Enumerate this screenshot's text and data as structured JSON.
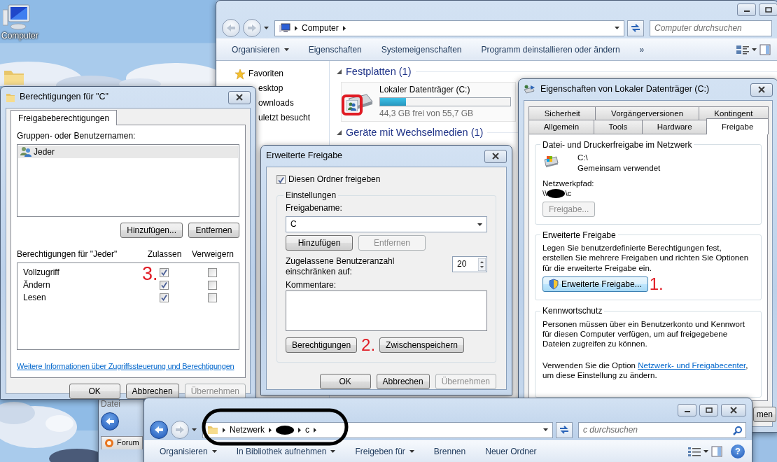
{
  "desktop": {
    "icons": [
      {
        "kind": "computer",
        "label": "Computer"
      },
      {
        "kind": "folder"
      }
    ]
  },
  "browser_behind": {
    "menu": "Datei",
    "tab": "Forum"
  },
  "explorer": {
    "address": [
      "Computer"
    ],
    "search_placeholder": "Computer durchsuchen",
    "toolbar": [
      {
        "label": "Organisieren",
        "dropdown": true
      },
      {
        "label": "Eigenschaften",
        "dropdown": false
      },
      {
        "label": "Systemeigenschaften",
        "dropdown": false
      },
      {
        "label": "Programm deinstallieren oder ändern",
        "dropdown": false
      },
      {
        "label": "»",
        "dropdown": false
      }
    ],
    "sidebar": [
      {
        "kind": "favorites",
        "label": "Favoriten"
      },
      {
        "kind": "link",
        "label": "esktop"
      },
      {
        "kind": "link",
        "label": "ownloads"
      },
      {
        "kind": "link",
        "label": "uletzt besucht"
      }
    ],
    "groups": [
      {
        "title": "Festplatten (1)",
        "expanded": true,
        "drives": [
          {
            "name": "Lokaler Datenträger (C:)",
            "level": 0.2,
            "space": "44,3 GB frei von 55,7 GB",
            "shared": true,
            "highlighted": true
          }
        ]
      },
      {
        "title": "Geräte mit Wechselmedien (1)",
        "expanded": true
      }
    ]
  },
  "permissions_dialog": {
    "title": "Berechtigungen für \"C\"",
    "tabs": [
      {
        "label": "Freigabeberechtigungen",
        "selected": true
      }
    ],
    "users_label": "Gruppen- oder Benutzernamen:",
    "users": [
      {
        "name": "Jeder",
        "selected": true
      }
    ],
    "user_buttons": [
      {
        "label": "Hinzufügen...",
        "disabled": false
      },
      {
        "label": "Entfernen",
        "disabled": false
      }
    ],
    "permissions_label": "Berechtigungen für \"Jeder\"",
    "columns": [
      "Zulassen",
      "Verweigern"
    ],
    "permissions": [
      {
        "name": "Vollzugriff",
        "allow": true,
        "deny": false
      },
      {
        "name": "Ändern",
        "allow": true,
        "deny": false
      },
      {
        "name": "Lesen",
        "allow": true,
        "deny": false
      }
    ],
    "annotation": "3.",
    "link": "Weitere Informationen über Zugriffssteuerung und Berechtigungen",
    "buttons": [
      {
        "label": "OK",
        "disabled": false
      },
      {
        "label": "Abbrechen",
        "disabled": false
      },
      {
        "label": "Übernehmen",
        "disabled": true
      }
    ]
  },
  "advanced_sharing_dialog": {
    "title": "Erweiterte Freigabe",
    "share": {
      "label": "Diesen Ordner freigeben",
      "checked": true
    },
    "group": "Einstellungen",
    "name_label": "Freigabename:",
    "name_value": "C",
    "name_buttons": [
      {
        "label": "Hinzufügen",
        "disabled": false
      },
      {
        "label": "Entfernen",
        "disabled": true
      }
    ],
    "limit_label": "Zugelassene Benutzeranzahl einschränken auf:",
    "limit_value": "20",
    "comment_label": "Kommentare:",
    "buttons_inner": [
      {
        "label": "Berechtigungen",
        "disabled": false
      },
      {
        "label": "Zwischenspeichern",
        "disabled": false
      }
    ],
    "annotation": "2.",
    "buttons": [
      {
        "label": "OK",
        "disabled": false
      },
      {
        "label": "Abbrechen",
        "disabled": false
      },
      {
        "label": "Übernehmen",
        "disabled": true
      }
    ]
  },
  "properties_dialog": {
    "title": "Eigenschaften von Lokaler Datenträger (C:)",
    "tab_rows": [
      [
        {
          "label": "Sicherheit",
          "selected": false
        },
        {
          "label": "Vorgängerversionen",
          "selected": false
        },
        {
          "label": "Kontingent",
          "selected": false
        }
      ],
      [
        {
          "label": "Allgemein",
          "selected": false
        },
        {
          "label": "Tools",
          "selected": false
        },
        {
          "label": "Hardware",
          "selected": false
        },
        {
          "label": "Freigabe",
          "selected": true
        }
      ]
    ],
    "network": {
      "title": "Datei- und Druckerfreigabe im Netzwerk",
      "path": "C:\\",
      "status": "Gemeinsam verwendet",
      "path_label": "Netzwerkpfad:",
      "path_prefix": "\\\\",
      "path_redacted": true,
      "path_suffix": "\\c",
      "button": {
        "label": "Freigabe...",
        "disabled": true
      }
    },
    "advanced": {
      "title": "Erweiterte Freigabe",
      "text": "Legen Sie benutzerdefinierte Berechtigungen fest, erstellen Sie mehrere Freigaben und richten Sie Optionen für die erweiterte Freigabe ein.",
      "button": {
        "label": "Erweiterte Freigabe...",
        "disabled": false
      },
      "annotation": "1."
    },
    "password": {
      "title": "Kennwortschutz",
      "text": "Personen müssen über ein Benutzerkonto und Kennwort für diesen Computer verfügen, um auf freigegebene Dateien zugreifen zu können.",
      "text2_before": "Verwenden Sie die Option ",
      "link": "Netzwerk- und Freigabecenter",
      "text2_after": ", um diese Einstellung zu ändern."
    },
    "buttons": [
      {
        "label": "men",
        "disabled": false
      }
    ]
  },
  "network_explorer": {
    "breadcrumb": [
      {
        "kind": "text",
        "label": "Netzwerk"
      },
      {
        "kind": "redacted"
      },
      {
        "kind": "text",
        "label": "c"
      }
    ],
    "circled": true,
    "search_placeholder": "c durchsuchen",
    "toolbar": [
      {
        "label": "Organisieren",
        "dropdown": true
      },
      {
        "label": "In Bibliothek aufnehmen",
        "dropdown": true
      },
      {
        "label": "Freigeben für",
        "dropdown": true
      },
      {
        "label": "Brennen",
        "dropdown": false
      },
      {
        "label": "Neuer Ordner",
        "dropdown": false
      }
    ],
    "help": "?"
  }
}
